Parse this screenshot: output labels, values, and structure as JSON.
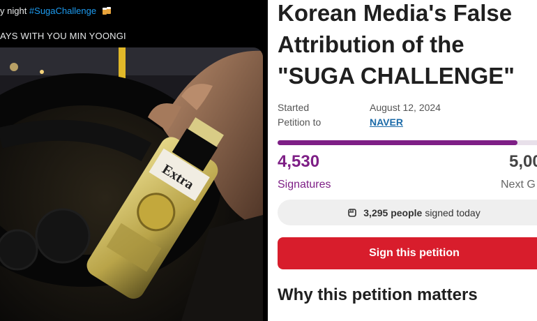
{
  "tweet": {
    "line1_prefix": "y night ",
    "hashtag": "#SugaChallenge",
    "line2": "AYS WITH YOU MIN YOONGI",
    "emoji_icon": "beer-mugs-icon",
    "photo_bottle_label": "Extra"
  },
  "petition": {
    "title": "Korean Media's False Attribution of the \"SUGA CHALLENGE\"",
    "started_label": "Started",
    "started_date": "August 12, 2024",
    "petition_to_label": "Petition to",
    "petition_to": "NAVER",
    "signatures": "4,530",
    "signatures_label": "Signatures",
    "next_goal": "5,00",
    "next_goal_label": "Next G",
    "progress_fraction": 0.906,
    "today_count": "3,295 people",
    "today_suffix": "signed today",
    "sign_button": "Sign this petition",
    "why_heading": "Why this petition matters"
  },
  "colors": {
    "accent_purple": "#7e1f86",
    "button_red": "#d81d2c",
    "link_blue": "#1b6aa8",
    "hashtag_blue": "#1d9bf0"
  }
}
